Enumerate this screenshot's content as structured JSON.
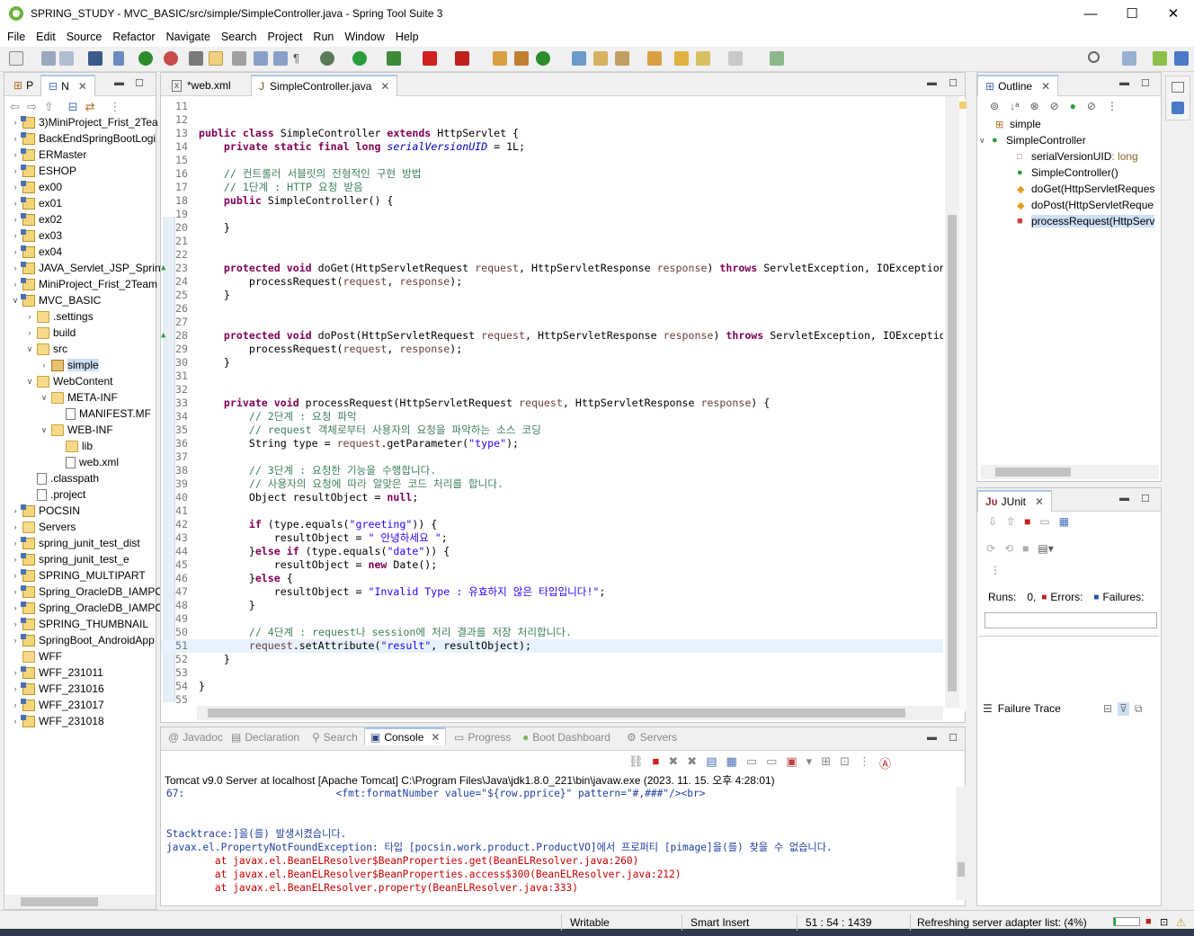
{
  "window": {
    "title": "SPRING_STUDY - MVC_BASIC/src/simple/SimpleController.java - Spring Tool Suite 3",
    "minimize": "—",
    "maximize": "☐",
    "close": "✕"
  },
  "menu": [
    "File",
    "Edit",
    "Source",
    "Refactor",
    "Navigate",
    "Search",
    "Project",
    "Run",
    "Window",
    "Help"
  ],
  "explorer": {
    "tab_p": "P",
    "tab_n": "N",
    "items": [
      {
        "label": "3)MiniProject_Frist_2Tea",
        "kind": "proj",
        "depth": 0,
        "expanded": false
      },
      {
        "label": "BackEndSpringBootLogi",
        "kind": "proj",
        "depth": 0,
        "expanded": false
      },
      {
        "label": "ERMaster",
        "kind": "proj",
        "depth": 0,
        "expanded": false
      },
      {
        "label": "ESHOP",
        "kind": "proj",
        "depth": 0,
        "expanded": false
      },
      {
        "label": "ex00",
        "kind": "proj",
        "depth": 0,
        "expanded": false
      },
      {
        "label": "ex01",
        "kind": "proj",
        "depth": 0,
        "expanded": false
      },
      {
        "label": "ex02",
        "kind": "proj",
        "depth": 0,
        "expanded": false
      },
      {
        "label": "ex03",
        "kind": "proj",
        "depth": 0,
        "expanded": false
      },
      {
        "label": "ex04",
        "kind": "proj",
        "depth": 0,
        "expanded": false
      },
      {
        "label": "JAVA_Servlet_JSP_Spring",
        "kind": "proj",
        "depth": 0,
        "expanded": false
      },
      {
        "label": "MiniProject_Frist_2Team",
        "kind": "proj",
        "depth": 0,
        "expanded": false
      },
      {
        "label": "MVC_BASIC",
        "kind": "proj",
        "depth": 0,
        "expanded": true
      },
      {
        "label": ".settings",
        "kind": "fold",
        "depth": 1,
        "expanded": false
      },
      {
        "label": "build",
        "kind": "fold",
        "depth": 1,
        "expanded": false
      },
      {
        "label": "src",
        "kind": "fold",
        "depth": 1,
        "expanded": true
      },
      {
        "label": "simple",
        "kind": "pkg",
        "depth": 2,
        "expanded": false,
        "selected": true
      },
      {
        "label": "WebContent",
        "kind": "fold",
        "depth": 1,
        "expanded": true
      },
      {
        "label": "META-INF",
        "kind": "fold",
        "depth": 2,
        "expanded": true
      },
      {
        "label": "MANIFEST.MF",
        "kind": "file",
        "depth": 3,
        "leaf": true
      },
      {
        "label": "WEB-INF",
        "kind": "fold",
        "depth": 2,
        "expanded": true
      },
      {
        "label": "lib",
        "kind": "fold",
        "depth": 3,
        "leaf": true
      },
      {
        "label": "web.xml",
        "kind": "file",
        "depth": 3,
        "leaf": true
      },
      {
        "label": ".classpath",
        "kind": "file",
        "depth": 1,
        "leaf": true
      },
      {
        "label": ".project",
        "kind": "file",
        "depth": 1,
        "leaf": true
      },
      {
        "label": "POCSIN",
        "kind": "proj",
        "depth": 0,
        "expanded": false
      },
      {
        "label": "Servers",
        "kind": "fold",
        "depth": 0,
        "expanded": false
      },
      {
        "label": "spring_junit_test_dist",
        "kind": "proj",
        "depth": 0,
        "expanded": false
      },
      {
        "label": "spring_junit_test_e",
        "kind": "proj",
        "depth": 0,
        "expanded": false
      },
      {
        "label": "SPRING_MULTIPART",
        "kind": "proj",
        "depth": 0,
        "expanded": false
      },
      {
        "label": "Spring_OracleDB_IAMPO",
        "kind": "proj",
        "depth": 0,
        "expanded": false
      },
      {
        "label": "Spring_OracleDB_IAMPO",
        "kind": "proj",
        "depth": 0,
        "expanded": false
      },
      {
        "label": "SPRING_THUMBNAIL",
        "kind": "proj",
        "depth": 0,
        "expanded": false
      },
      {
        "label": "SpringBoot_AndroidApp",
        "kind": "proj",
        "depth": 0,
        "expanded": false
      },
      {
        "label": "WFF",
        "kind": "fold",
        "depth": 0,
        "leaf": true
      },
      {
        "label": "WFF_231011",
        "kind": "proj",
        "depth": 0,
        "expanded": false
      },
      {
        "label": "WFF_231016",
        "kind": "proj",
        "depth": 0,
        "expanded": false
      },
      {
        "label": "WFF_231017",
        "kind": "proj",
        "depth": 0,
        "expanded": false
      },
      {
        "label": "WFF_231018",
        "kind": "proj",
        "depth": 0,
        "expanded": false
      }
    ]
  },
  "editor": {
    "tabs": [
      {
        "label": "*web.xml",
        "active": false
      },
      {
        "label": "SimpleController.java",
        "active": true
      }
    ],
    "lines": [
      {
        "n": "11",
        "t": ""
      },
      {
        "n": "12",
        "t": ""
      },
      {
        "n": "13",
        "t": "public class SimpleController extends HttpServlet {"
      },
      {
        "n": "14",
        "t": "    private static final long serialVersionUID = 1L;"
      },
      {
        "n": "15",
        "t": ""
      },
      {
        "n": "16",
        "t": "    // 컨트롤러 서블릿의 전형적인 구현 방법"
      },
      {
        "n": "17",
        "t": "    // 1단계 : HTTP 요청 받음"
      },
      {
        "n": "18",
        "t": "    public SimpleController() {"
      },
      {
        "n": "19",
        "t": ""
      },
      {
        "n": "20",
        "t": "    }"
      },
      {
        "n": "21",
        "t": ""
      },
      {
        "n": "22",
        "t": ""
      },
      {
        "n": "23",
        "t": "    protected void doGet(HttpServletRequest request, HttpServletResponse response) throws ServletException, IOException"
      },
      {
        "n": "24",
        "t": "        processRequest(request, response);"
      },
      {
        "n": "25",
        "t": "    }"
      },
      {
        "n": "26",
        "t": ""
      },
      {
        "n": "27",
        "t": ""
      },
      {
        "n": "28",
        "t": "    protected void doPost(HttpServletRequest request, HttpServletResponse response) throws ServletException, IOExceptio"
      },
      {
        "n": "29",
        "t": "        processRequest(request, response);"
      },
      {
        "n": "30",
        "t": "    }"
      },
      {
        "n": "31",
        "t": ""
      },
      {
        "n": "32",
        "t": ""
      },
      {
        "n": "33",
        "t": "    private void processRequest(HttpServletRequest request, HttpServletResponse response) {"
      },
      {
        "n": "34",
        "t": "        // 2단계 : 요청 파악"
      },
      {
        "n": "35",
        "t": "        // request 객체로부터 사용자의 요청을 파악하는 소스 코딩"
      },
      {
        "n": "36",
        "t": "        String type = request.getParameter(\"type\");"
      },
      {
        "n": "37",
        "t": ""
      },
      {
        "n": "38",
        "t": "        // 3단계 : 요청한 기능을 수행합니다."
      },
      {
        "n": "39",
        "t": "        // 사용자의 요청에 따라 알맞은 코드 처리를 합니다."
      },
      {
        "n": "40",
        "t": "        Object resultObject = null;"
      },
      {
        "n": "41",
        "t": ""
      },
      {
        "n": "42",
        "t": "        if (type.equals(\"greeting\")) {"
      },
      {
        "n": "43",
        "t": "            resultObject = \" 안녕하세요 \";"
      },
      {
        "n": "44",
        "t": "        }else if (type.equals(\"date\")) {"
      },
      {
        "n": "45",
        "t": "            resultObject = new Date();"
      },
      {
        "n": "46",
        "t": "        }else {"
      },
      {
        "n": "47",
        "t": "            resultObject = \"Invalid Type : 유효하지 않은 타입입니다!\";"
      },
      {
        "n": "48",
        "t": "        }"
      },
      {
        "n": "49",
        "t": ""
      },
      {
        "n": "50",
        "t": "        // 4단계 : request나 session에 처리 결과를 저장 처리합니다."
      },
      {
        "n": "51",
        "t": "        request.setAttribute(\"result\", resultObject);"
      },
      {
        "n": "52",
        "t": "    }"
      },
      {
        "n": "53",
        "t": ""
      },
      {
        "n": "54",
        "t": "}"
      },
      {
        "n": "55",
        "t": ""
      }
    ]
  },
  "outline": {
    "title": "Outline",
    "items": [
      {
        "label": "simple",
        "depth": 0
      },
      {
        "label": "SimpleController",
        "depth": 0
      },
      {
        "label": "serialVersionUID",
        "suffix": " : long",
        "depth": 1
      },
      {
        "label": "SimpleController()",
        "depth": 1
      },
      {
        "label": "doGet(HttpServletReques",
        "depth": 1
      },
      {
        "label": "doPost(HttpServletReque",
        "depth": 1
      },
      {
        "label": "processRequest(HttpServ",
        "depth": 1,
        "selected": true
      }
    ]
  },
  "junit": {
    "title": "JUnit",
    "runs_label": "Runs:",
    "runs_value": "0,",
    "errors_label": "Errors:",
    "failures_label": "Failures:",
    "failure_trace": "Failure Trace"
  },
  "console": {
    "tabs": [
      "Javadoc",
      "Declaration",
      "Search",
      "Console",
      "Progress",
      "Boot Dashboard",
      "Servers"
    ],
    "active_tab": "Console",
    "header": "Tomcat v9.0 Server at localhost [Apache Tomcat] C:\\Program Files\\Java\\jdk1.8.0_221\\bin\\javaw.exe  (2023. 11. 15. 오후 4:28:01)",
    "lines": [
      {
        "t": "67:                         <fmt:formatNumber value=\"${row.pprice}\" pattern=\"#,###\"/><br>",
        "c": "blue"
      },
      {
        "t": "",
        "c": ""
      },
      {
        "t": "",
        "c": ""
      },
      {
        "t": "Stacktrace:]을(를) 발생시켰습니다.",
        "c": "blue"
      },
      {
        "t": "javax.el.PropertyNotFoundException: 타입 [pocsin.work.product.ProductVO]에서 프로퍼티 [pimage]을(를) 찾을 수 없습니다.",
        "c": "blue"
      },
      {
        "t": "        at javax.el.BeanELResolver$BeanProperties.get(BeanELResolver.java:260)",
        "c": "err"
      },
      {
        "t": "        at javax.el.BeanELResolver$BeanProperties.access$300(BeanELResolver.java:212)",
        "c": "err"
      },
      {
        "t": "        at javax.el.BeanELResolver.property(BeanELResolver.java:333)",
        "c": "err"
      }
    ]
  },
  "status": {
    "writable": "Writable",
    "insert_mode": "Smart Insert",
    "position": "51 : 54 : 1439",
    "task": "Refreshing server adapter list: (4%)",
    "progress": 0.04
  },
  "colors": {
    "keyword": "#7f0055",
    "comment": "#3f7f5f",
    "string": "#2a00ff",
    "field": "#0000c0",
    "error": "#c80000"
  }
}
